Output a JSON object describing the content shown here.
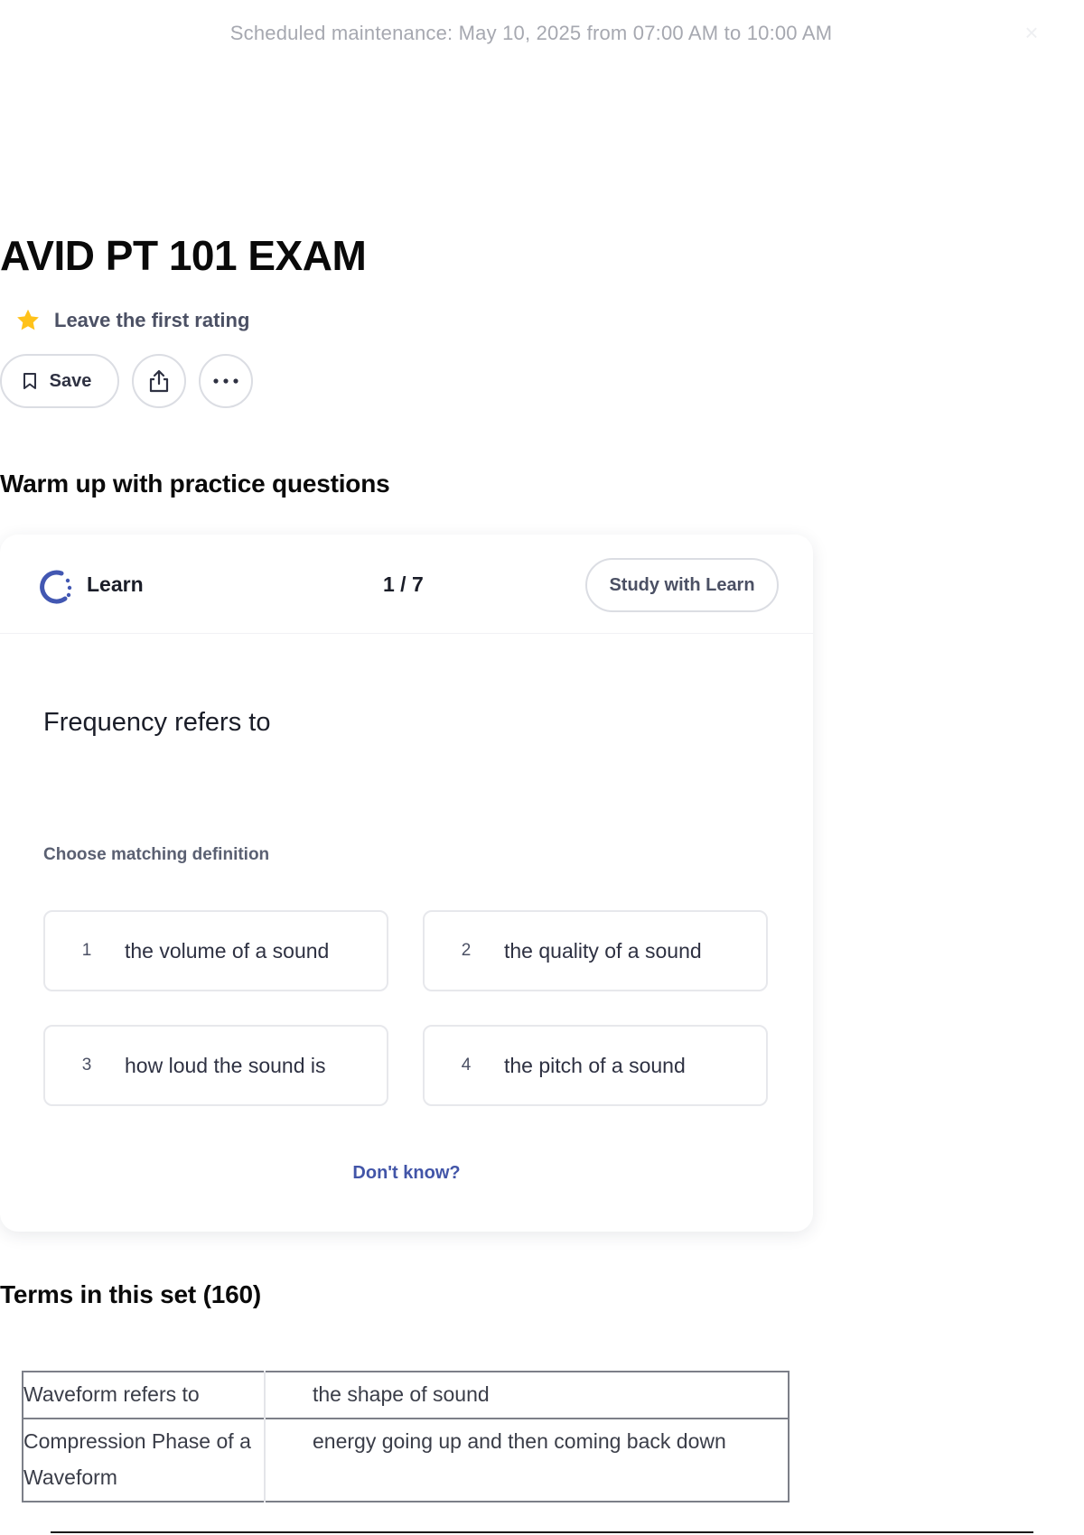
{
  "banner": {
    "text": "Scheduled maintenance: May 10, 2025 from 07:00 AM to 10:00 AM",
    "close_glyph": "×"
  },
  "set": {
    "title": "AVID PT 101 EXAM",
    "rating_text": "Leave the first rating"
  },
  "actions": {
    "save_label": "Save",
    "share_icon": "share-icon",
    "more_icon": "more-icon"
  },
  "practice": {
    "heading": "Warm up with practice questions",
    "mode_label": "Learn",
    "progress": "1 / 7",
    "study_button": "Study with Learn",
    "question": "Frequency refers to",
    "prompt": "Choose matching definition",
    "options": [
      {
        "num": "1",
        "text": "the volume of a sound"
      },
      {
        "num": "2",
        "text": "the quality of a sound"
      },
      {
        "num": "3",
        "text": "how loud the sound is"
      },
      {
        "num": "4",
        "text": "the pitch of a sound"
      }
    ],
    "dont_know": "Don't know?"
  },
  "terms": {
    "heading": "Terms in this set (160)",
    "rows": [
      {
        "term": "Waveform refers to",
        "definition": "the shape of sound"
      },
      {
        "term": "Compression Phase of a Waveform",
        "definition": "energy going up and then coming back down"
      }
    ]
  },
  "colors": {
    "accent": "#4255a8",
    "learn_icon": "#4257b2",
    "star": "#ffc21a"
  }
}
